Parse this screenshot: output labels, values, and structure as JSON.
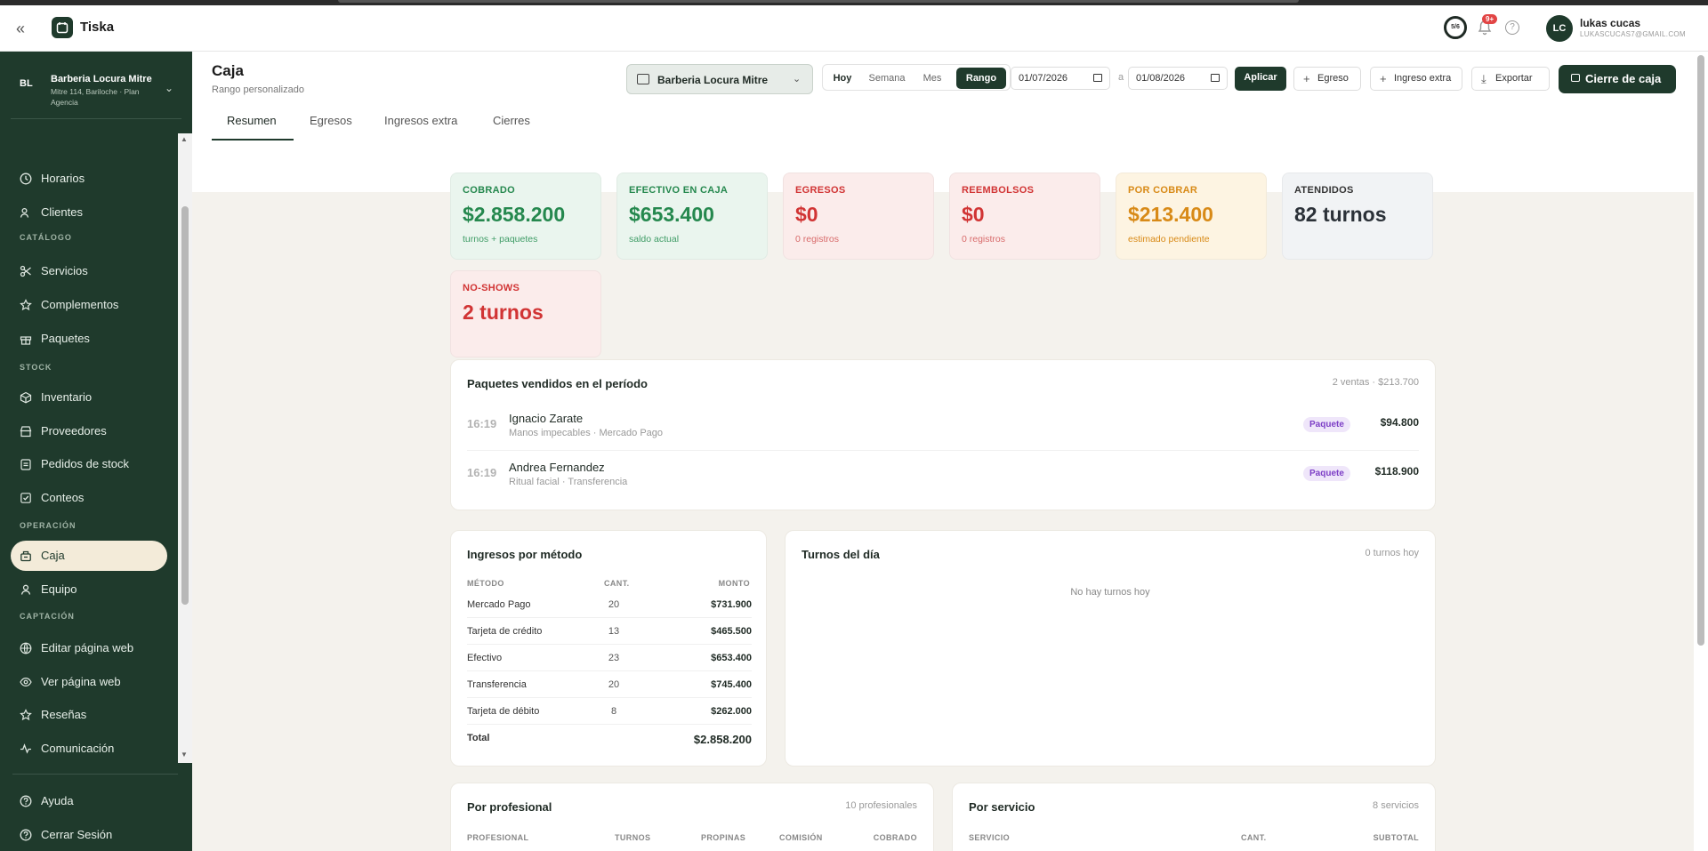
{
  "app": {
    "name": "Tiska"
  },
  "header": {
    "progress": "5/6",
    "notifications_badge": "9+",
    "user": {
      "initials": "LC",
      "name": "lukas cucas",
      "email": "LUKASCUCAS7@GMAIL.COM"
    }
  },
  "workspace": {
    "initials": "BL",
    "name": "Barberia Locura Mitre",
    "subtitle": "Mitre 114, Bariloche · Plan Agencia"
  },
  "sidebar": {
    "items": [
      {
        "label": "Horarios",
        "icon": "clock-icon"
      },
      {
        "label": "Clientes",
        "icon": "users-icon"
      },
      {
        "section": "CATÁLOGO"
      },
      {
        "label": "Servicios",
        "icon": "scissors-icon"
      },
      {
        "label": "Complementos",
        "icon": "star-icon"
      },
      {
        "label": "Paquetes",
        "icon": "gift-icon"
      },
      {
        "section": "STOCK"
      },
      {
        "label": "Inventario",
        "icon": "box-icon"
      },
      {
        "label": "Proveedores",
        "icon": "store-icon"
      },
      {
        "label": "Pedidos de stock",
        "icon": "clipboard-icon"
      },
      {
        "label": "Conteos",
        "icon": "checklist-icon"
      },
      {
        "section": "OPERACIÓN"
      },
      {
        "label": "Caja",
        "icon": "cash-register-icon",
        "active": true
      },
      {
        "label": "Equipo",
        "icon": "team-icon"
      },
      {
        "section": "CAPTACIÓN"
      },
      {
        "label": "Editar página web",
        "icon": "globe-icon"
      },
      {
        "label": "Ver página web",
        "icon": "eye-icon"
      },
      {
        "label": "Reseñas",
        "icon": "star-icon"
      },
      {
        "label": "Comunicación",
        "icon": "activity-icon"
      }
    ],
    "footer": [
      {
        "label": "Ayuda",
        "icon": "help-icon"
      },
      {
        "label": "Cerrar Sesión",
        "icon": "logout-icon"
      }
    ]
  },
  "page": {
    "title": "Caja",
    "subtitle": "Rango personalizado",
    "branch": "Barberia Locura Mitre",
    "range_buttons": [
      "Hoy",
      "Semana",
      "Mes",
      "Rango"
    ],
    "range_active": "Rango",
    "date_from": "01/07/2026",
    "date_sep": "a",
    "date_to": "01/08/2026",
    "apply_label": "Aplicar",
    "egreso_label": "Egreso",
    "ingreso_label": "Ingreso extra",
    "export_label": "Exportar",
    "close_label": "Cierre de caja"
  },
  "tabs": [
    "Resumen",
    "Egresos",
    "Ingresos extra",
    "Cierres"
  ],
  "stats": [
    {
      "title": "COBRADO",
      "value": "$2.858.200",
      "sub": "turnos + paquetes",
      "tone": "green"
    },
    {
      "title": "EFECTIVO EN CAJA",
      "value": "$653.400",
      "sub": "saldo actual",
      "tone": "green"
    },
    {
      "title": "EGRESOS",
      "value": "$0",
      "sub": "0 registros",
      "tone": "red"
    },
    {
      "title": "REEMBOLSOS",
      "value": "$0",
      "sub": "0 registros",
      "tone": "red"
    },
    {
      "title": "POR COBRAR",
      "value": "$213.400",
      "sub": "estimado pendiente",
      "tone": "amber"
    },
    {
      "title": "ATENDIDOS",
      "value": "82 turnos",
      "sub": "",
      "tone": "gray"
    },
    {
      "title": "NO-SHOWS",
      "value": "2 turnos",
      "sub": "",
      "tone": "red"
    }
  ],
  "packages": {
    "title": "Paquetes vendidos en el período",
    "meta": "2 ventas · $213.700",
    "rows": [
      {
        "time": "16:19",
        "name": "Ignacio Zarate",
        "sub": "Manos impecables · Mercado Pago",
        "badge": "Paquete",
        "amount": "$94.800"
      },
      {
        "time": "16:19",
        "name": "Andrea Fernandez",
        "sub": "Ritual facial · Transferencia",
        "badge": "Paquete",
        "amount": "$118.900"
      }
    ]
  },
  "methods": {
    "title": "Ingresos por método",
    "headers": [
      "MÉTODO",
      "CANT.",
      "MONTO"
    ],
    "rows": [
      {
        "method": "Mercado Pago",
        "qty": "20",
        "amount": "$731.900"
      },
      {
        "method": "Tarjeta de crédito",
        "qty": "13",
        "amount": "$465.500"
      },
      {
        "method": "Efectivo",
        "qty": "23",
        "amount": "$653.400"
      },
      {
        "method": "Transferencia",
        "qty": "20",
        "amount": "$745.400"
      },
      {
        "method": "Tarjeta de débito",
        "qty": "8",
        "amount": "$262.000"
      }
    ],
    "total_label": "Total",
    "total": "$2.858.200"
  },
  "turnos": {
    "title": "Turnos del día",
    "meta": "0 turnos hoy",
    "empty": "No hay turnos hoy"
  },
  "professionals": {
    "title": "Por profesional",
    "meta": "10 profesionales",
    "headers": [
      "PROFESIONAL",
      "TURNOS",
      "PROPINAS",
      "COMISIÓN",
      "COBRADO"
    ]
  },
  "services": {
    "title": "Por servicio",
    "meta": "8 servicios",
    "headers": [
      "SERVICIO",
      "CANT.",
      "SUBTOTAL"
    ]
  },
  "colors": {
    "brand": "#1f3a2c",
    "active_nav": "#f3ebd9",
    "green": "#25884e",
    "red": "#d13434",
    "amber": "#d88a17"
  }
}
